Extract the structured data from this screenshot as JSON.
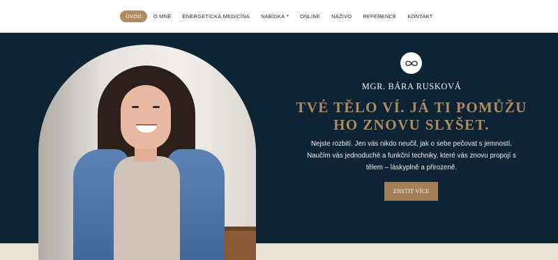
{
  "nav": {
    "items": [
      {
        "label": "ÚVOD",
        "active": true
      },
      {
        "label": "O MNĚ",
        "active": false
      },
      {
        "label": "ENERGETICKÁ MEDICÍNA",
        "active": false
      },
      {
        "label": "NABÍDKA",
        "active": false,
        "has_dropdown": true
      },
      {
        "label": "ONLINE",
        "active": false
      },
      {
        "label": "NAŽIVO",
        "active": false
      },
      {
        "label": "REFERENCE",
        "active": false
      },
      {
        "label": "KONTAKT",
        "active": false
      }
    ],
    "caret_icon": "▾"
  },
  "hero": {
    "logo_icon": "infinity-icon",
    "name": "MGR. BÁRA RUSKOVÁ",
    "headline_line1": "TVÉ TĚLO VÍ. JÁ TI POMŮŽU",
    "headline_line2": "HO ZNOVU SLYŠET.",
    "body_line1": "Nejste rozbití. Jen vás nikdo neučil, jak o sebe pečovat s jemností.",
    "body_line2": "Naučím vás jednoduché a funkční techniky, které vás znovu propojí s",
    "body_line3": "tělem – láskyplně a přirozeně.",
    "cta_label": "ZJISTIT VÍCE"
  },
  "colors": {
    "hero_background": "#0d2434",
    "accent_gold": "#b08b62",
    "button": "#a47e56",
    "bottom_band": "#eae1d6"
  }
}
